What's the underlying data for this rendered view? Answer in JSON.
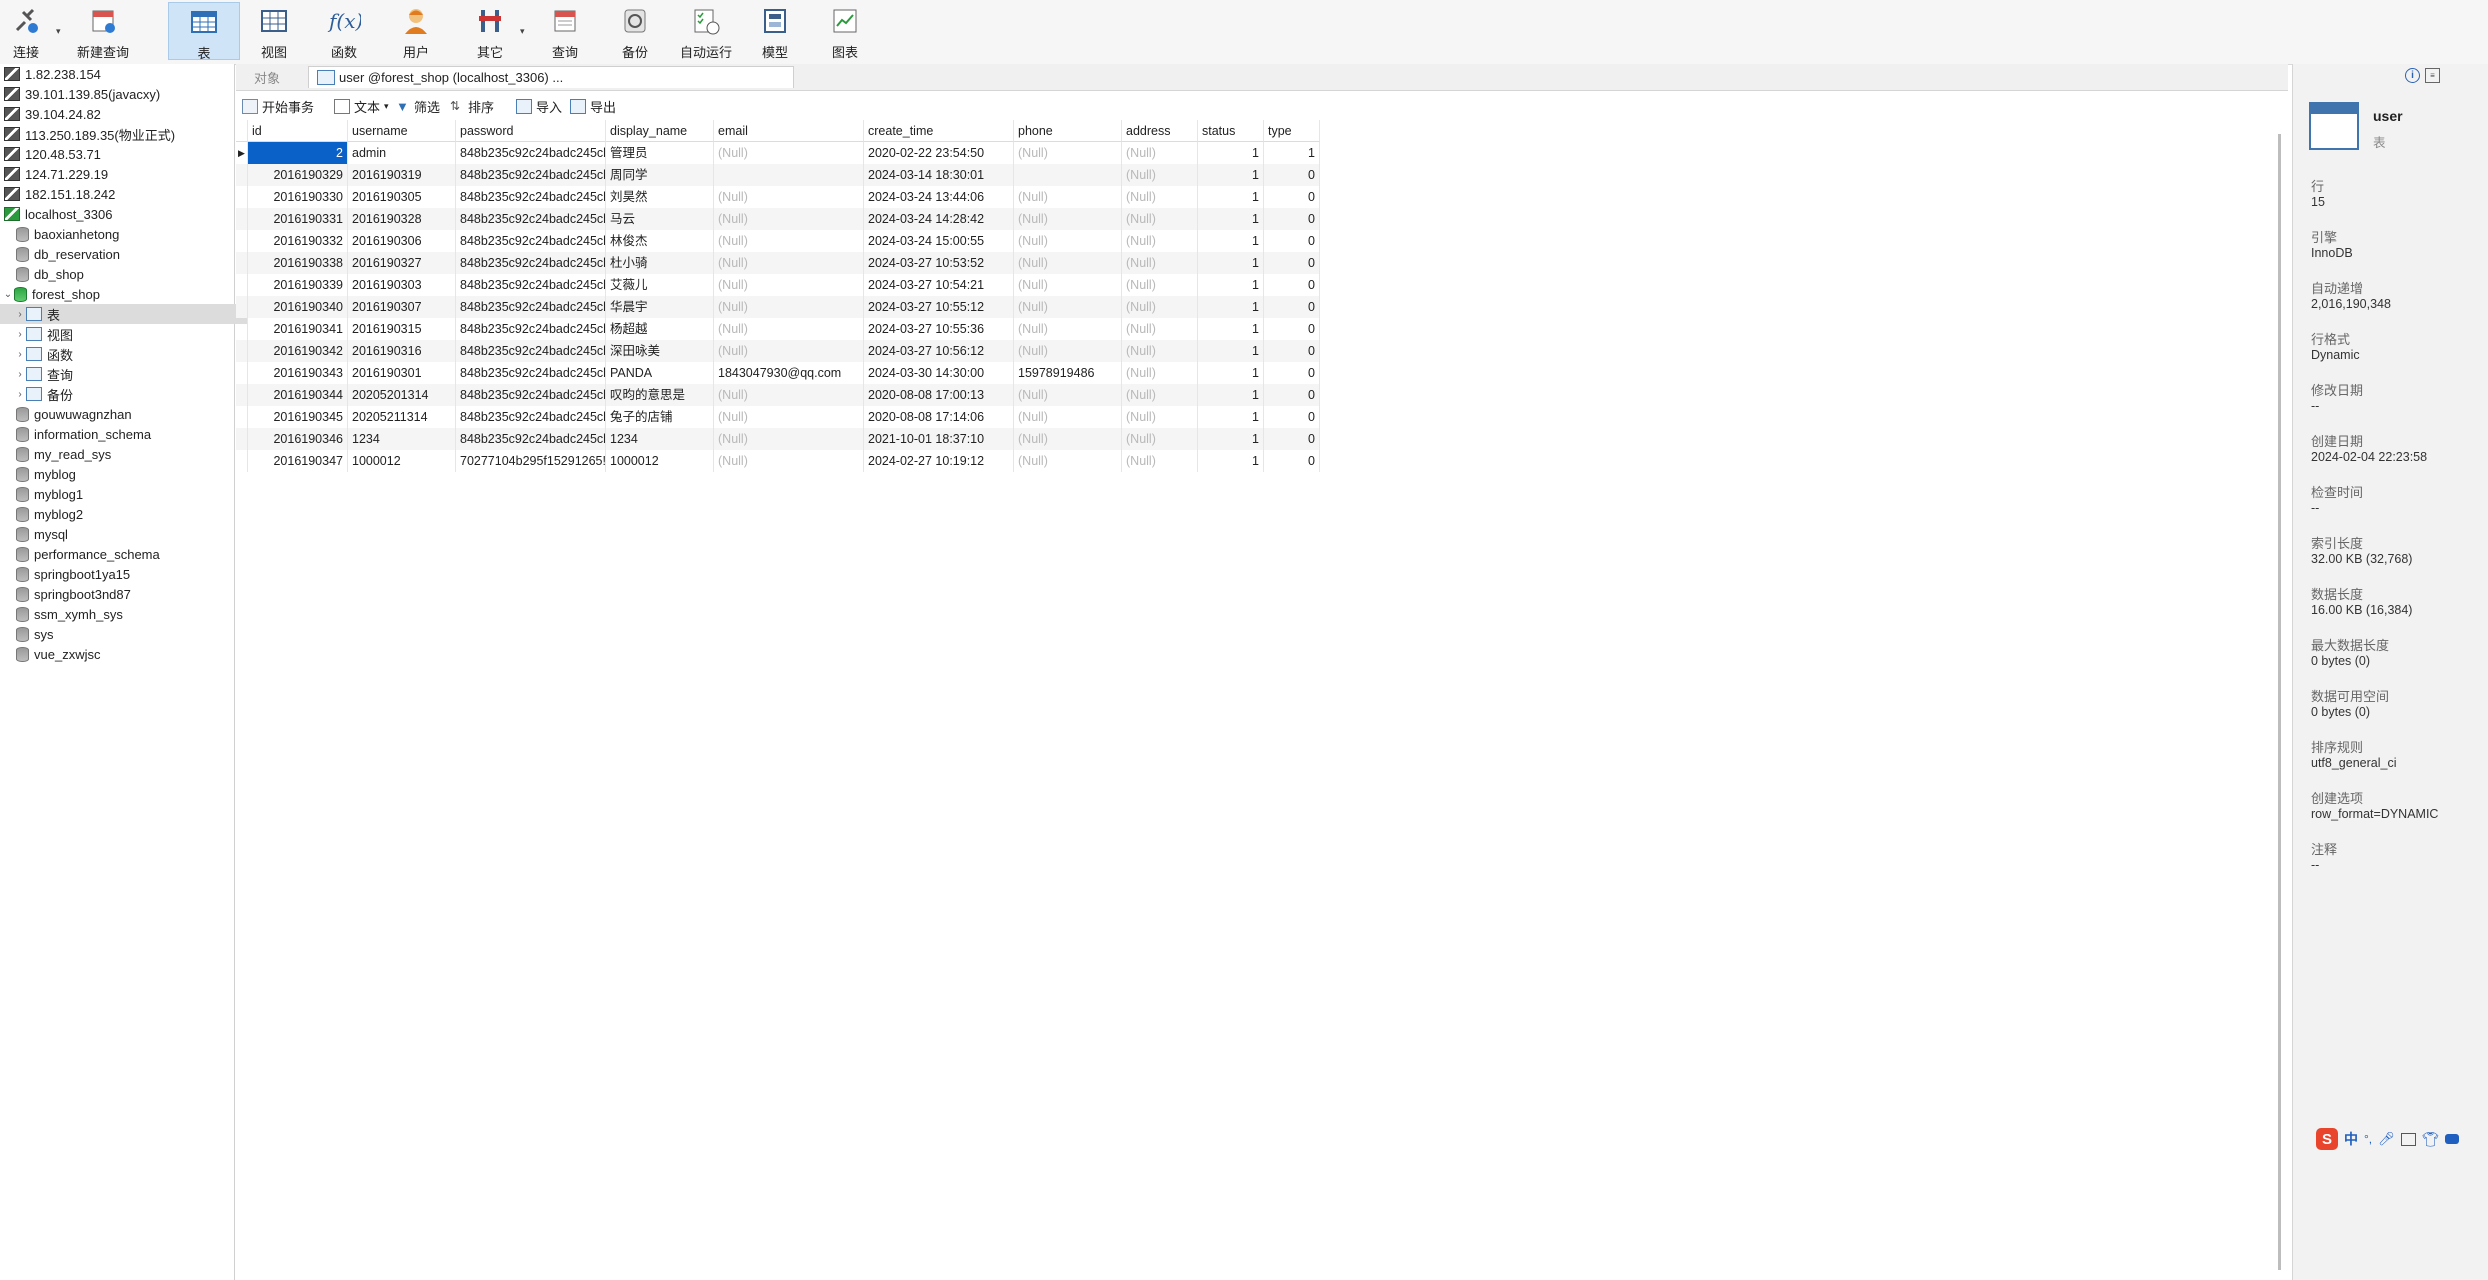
{
  "toolbar": {
    "buttons": [
      {
        "label": "连接",
        "icon": "plug-connect-icon"
      },
      {
        "label": "新建查询",
        "icon": "new-query-icon"
      },
      {
        "label": "表",
        "icon": "table-icon"
      },
      {
        "label": "视图",
        "icon": "view-icon"
      },
      {
        "label": "函数",
        "icon": "function-icon"
      },
      {
        "label": "用户",
        "icon": "user-icon"
      },
      {
        "label": "其它",
        "icon": "tools-icon"
      },
      {
        "label": "查询",
        "icon": "query-icon"
      },
      {
        "label": "备份",
        "icon": "backup-icon"
      },
      {
        "label": "自动运行",
        "icon": "automation-icon"
      },
      {
        "label": "模型",
        "icon": "model-icon"
      },
      {
        "label": "图表",
        "icon": "chart-icon"
      }
    ]
  },
  "sidebar": {
    "connections": [
      "1.82.238.154",
      "39.101.139.85(javacxy)",
      "39.104.24.82",
      "113.250.189.35(物业正式)",
      "120.48.53.71",
      "124.71.229.19",
      "182.151.18.242",
      "localhost_3306"
    ],
    "databases_before": [
      "baoxianhetong",
      "db_reservation",
      "db_shop",
      "forest_shop"
    ],
    "forest_children": [
      "表",
      "视图",
      "函数",
      "查询",
      "备份"
    ],
    "databases_after": [
      "gouwuwagnzhan",
      "information_schema",
      "my_read_sys",
      "myblog",
      "myblog1",
      "myblog2",
      "mysql",
      "performance_schema",
      "springboot1ya15",
      "springboot3nd87",
      "ssm_xymh_sys",
      "sys",
      "vue_zxwjsc"
    ]
  },
  "tabs": {
    "objects_label": "对象",
    "active_label": "user @forest_shop (localhost_3306) ..."
  },
  "subbar": {
    "begin_tx": "开始事务",
    "text": "文本",
    "filter": "筛选",
    "sort": "排序",
    "import": "导入",
    "export": "导出"
  },
  "grid": {
    "columns": [
      "id",
      "username",
      "password",
      "display_name",
      "email",
      "create_time",
      "phone",
      "address",
      "status",
      "type"
    ],
    "rows": [
      [
        "2",
        "admin",
        "848b235c92c24badc245cl",
        "管理员",
        "(Null)",
        "2020-02-22 23:54:50",
        "(Null)",
        "(Null)",
        "1",
        "1"
      ],
      [
        "2016190329",
        "2016190319",
        "848b235c92c24badc245cl",
        "周同学",
        "",
        "2024-03-14 18:30:01",
        "",
        "(Null)",
        "1",
        "0"
      ],
      [
        "2016190330",
        "2016190305",
        "848b235c92c24badc245cl",
        "刘昊然",
        "(Null)",
        "2024-03-24 13:44:06",
        "(Null)",
        "(Null)",
        "1",
        "0"
      ],
      [
        "2016190331",
        "2016190328",
        "848b235c92c24badc245cl",
        "马云",
        "(Null)",
        "2024-03-24 14:28:42",
        "(Null)",
        "(Null)",
        "1",
        "0"
      ],
      [
        "2016190332",
        "2016190306",
        "848b235c92c24badc245cl",
        "林俊杰",
        "(Null)",
        "2024-03-24 15:00:55",
        "(Null)",
        "(Null)",
        "1",
        "0"
      ],
      [
        "2016190338",
        "2016190327",
        "848b235c92c24badc245cl",
        "杜小骑",
        "(Null)",
        "2024-03-27 10:53:52",
        "(Null)",
        "(Null)",
        "1",
        "0"
      ],
      [
        "2016190339",
        "2016190303",
        "848b235c92c24badc245cl",
        "艾薇儿",
        "(Null)",
        "2024-03-27 10:54:21",
        "(Null)",
        "(Null)",
        "1",
        "0"
      ],
      [
        "2016190340",
        "2016190307",
        "848b235c92c24badc245cl",
        "华晨宇",
        "(Null)",
        "2024-03-27 10:55:12",
        "(Null)",
        "(Null)",
        "1",
        "0"
      ],
      [
        "2016190341",
        "2016190315",
        "848b235c92c24badc245cl",
        "杨超越",
        "(Null)",
        "2024-03-27 10:55:36",
        "(Null)",
        "(Null)",
        "1",
        "0"
      ],
      [
        "2016190342",
        "2016190316",
        "848b235c92c24badc245cl",
        "深田咏美",
        "(Null)",
        "2024-03-27 10:56:12",
        "(Null)",
        "(Null)",
        "1",
        "0"
      ],
      [
        "2016190343",
        "2016190301",
        "848b235c92c24badc245cl",
        "PANDA",
        "1843047930@qq.com",
        "2024-03-30 14:30:00",
        "15978919486",
        "(Null)",
        "1",
        "0"
      ],
      [
        "2016190344",
        "20205201314",
        "848b235c92c24badc245cl",
        "叹昀的意思是",
        "(Null)",
        "2020-08-08 17:00:13",
        "(Null)",
        "(Null)",
        "1",
        "0"
      ],
      [
        "2016190345",
        "20205211314",
        "848b235c92c24badc245cl",
        "兔子的店铺",
        "(Null)",
        "2020-08-08 17:14:06",
        "(Null)",
        "(Null)",
        "1",
        "0"
      ],
      [
        "2016190346",
        "1234",
        "848b235c92c24badc245cl",
        "1234",
        "(Null)",
        "2021-10-01 18:37:10",
        "(Null)",
        "(Null)",
        "1",
        "0"
      ],
      [
        "2016190347",
        "1000012",
        "70277104b295f15291265!",
        "1000012",
        "(Null)",
        "2024-02-27 10:19:12",
        "(Null)",
        "(Null)",
        "1",
        "0"
      ]
    ]
  },
  "panel": {
    "table_name": "user",
    "table_type": "表",
    "props": [
      {
        "label": "行",
        "value": "15"
      },
      {
        "label": "引擎",
        "value": "InnoDB"
      },
      {
        "label": "自动递增",
        "value": "2,016,190,348"
      },
      {
        "label": "行格式",
        "value": "Dynamic"
      },
      {
        "label": "修改日期",
        "value": "--"
      },
      {
        "label": "创建日期",
        "value": "2024-02-04 22:23:58"
      },
      {
        "label": "检查时间",
        "value": "--"
      },
      {
        "label": "索引长度",
        "value": "32.00 KB (32,768)"
      },
      {
        "label": "数据长度",
        "value": "16.00 KB (16,384)"
      },
      {
        "label": "最大数据长度",
        "value": "0 bytes (0)"
      },
      {
        "label": "数据可用空间",
        "value": "0 bytes (0)"
      },
      {
        "label": "排序规则",
        "value": "utf8_general_ci"
      },
      {
        "label": "创建选项",
        "value": "row_format=DYNAMIC"
      },
      {
        "label": "注释",
        "value": "--"
      }
    ]
  },
  "ime": {
    "lang": "中",
    "punct": "°,"
  },
  "colors": {
    "accent": "#0a62c9",
    "active_button": "#cfe4f7",
    "null_text": "#b9b9b9"
  }
}
